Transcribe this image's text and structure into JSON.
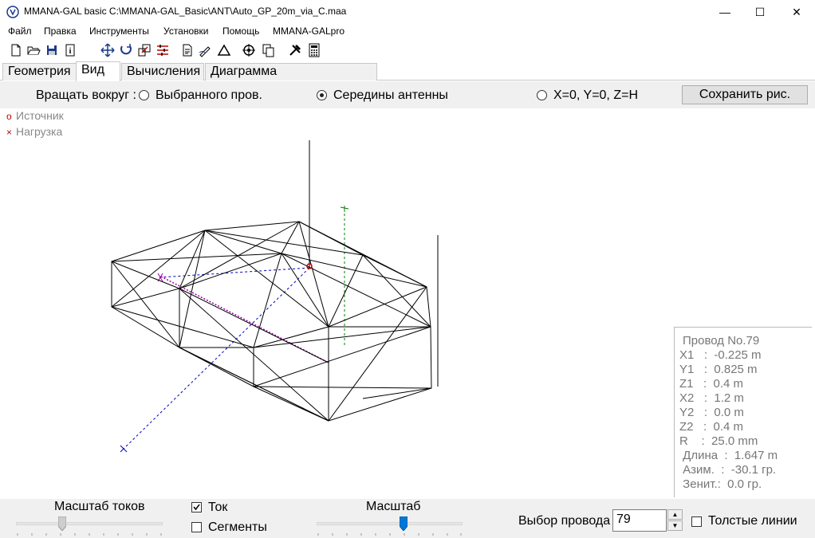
{
  "window": {
    "title": "MMANA-GAL basic C:\\MMANA-GAL_Basic\\ANT\\Auto_GP_20m_via_C.maa",
    "minimize": "—",
    "maximize": "☐",
    "close": "✕"
  },
  "menu": [
    "Файл",
    "Правка",
    "Инструменты",
    "Установки",
    "Помощь",
    "MMANA-GALpro"
  ],
  "toolbar_icons": [
    "new-file-icon",
    "open-folder-icon",
    "save-icon",
    "info-icon",
    "move-icon",
    "rotate-icon",
    "scale-icon",
    "wire-edit-icon",
    "notes-icon",
    "pen-icon",
    "triangle-icon",
    "target-icon",
    "copy-icon",
    "tools-icon",
    "calculator-icon"
  ],
  "tabs": [
    "Геометрия",
    "Вид",
    "Вычисления",
    "Диаграмма направленности"
  ],
  "active_tab": "Вид",
  "rotate": {
    "label": "Вращать вокруг :",
    "options": [
      "Выбранного пров.",
      "Середины антенны",
      "X=0, Y=0, Z=H"
    ],
    "selected": "Середины антенны",
    "save_button": "Сохранить рис."
  },
  "legend": {
    "source": "Источник",
    "load": "Нагрузка",
    "source_symbol": "o",
    "load_symbol": "×"
  },
  "wire_info": {
    "title": "Провод No.79",
    "x1": "X1   :  -0.225 m",
    "y1": "Y1   :  0.825 m",
    "z1": "Z1   :  0.4 m",
    "x2": "X2   :  1.2 m",
    "y2": "Y2   :  0.0 m",
    "z2": "Z2   :  0.4 m",
    "r": "R    :  25.0 mm",
    "length": " Длина  :  1.647 m",
    "azimuth": " Азим.  :  -30.1 гр.",
    "zenith": " Зенит.:  0.0 гр."
  },
  "bottom": {
    "current_scale_label": "Масштаб токов",
    "current_checkbox": "Ток",
    "current_checked": true,
    "segments_checkbox": "Сегменты",
    "segments_checked": false,
    "scale_label": "Масштаб",
    "wire_select_label": "Выбор провода",
    "wire_select_value": "79",
    "thick_lines_checkbox": "Толстые линии",
    "thick_lines_checked": false
  },
  "colors": {
    "wire": "#000000",
    "axis_x": "#0000c0",
    "axis_y": "#0000c0",
    "axis_z": "#008000",
    "selected_wire": "#a000a0",
    "source": "#c00000",
    "slider_thumb_active": "#0078d7"
  }
}
